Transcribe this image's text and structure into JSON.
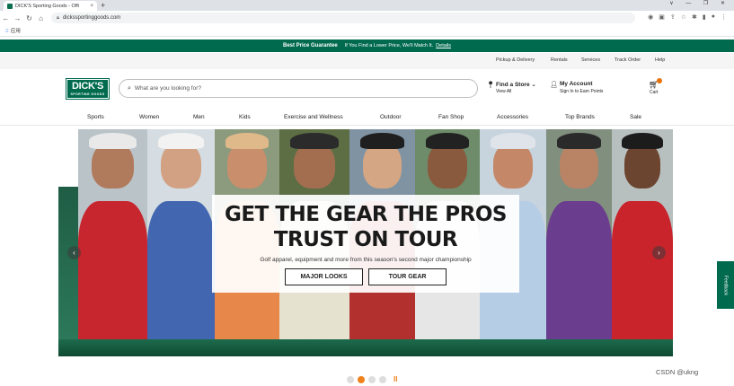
{
  "browser": {
    "tab_title": "DICK'S Sporting Goods - Offi",
    "tab_close": "×",
    "new_tab": "+",
    "url": "dickssportinggoods.com",
    "bookmark_label": "应用",
    "window_controls": "∨ — ❐ ✕"
  },
  "promo": {
    "title": "Best Price Guarantee",
    "text": "If You Find a Lower Price, We'll Match It.",
    "link": "Details"
  },
  "utility": {
    "links": [
      "Pickup & Delivery",
      "Rentals",
      "Services",
      "Track Order",
      "Help"
    ]
  },
  "header": {
    "logo_main": "DICK'S",
    "logo_sub": "SPORTING GOODS",
    "search_placeholder": "What are you looking for?",
    "store_title": "Find a Store",
    "store_sub": "View All",
    "account_title": "My Account",
    "account_sub": "Sign In to Earn Points",
    "cart_label": "Cart"
  },
  "nav": {
    "items": [
      "Sports",
      "Women",
      "Men",
      "Kids",
      "Exercise and Wellness",
      "Outdoor",
      "Fan Shop",
      "Accessories",
      "Top Brands",
      "Sale"
    ]
  },
  "hero": {
    "headline_1": "GET THE GEAR THE PROS",
    "headline_2": "TRUST ON TOUR",
    "subtext": "Golf apparel, equipment and more from this season's second major championship",
    "button_1": "MAJOR LOOKS",
    "button_2": "TOUR GEAR",
    "prev_arrow": "‹",
    "next_arrow": "›"
  },
  "carousel": {
    "active_index": 1,
    "count": 4,
    "pause": "II"
  },
  "feedback_label": "Feedback",
  "watermark": "CSDN @ukng",
  "colors": {
    "brand_green": "#006a4e",
    "accent_orange": "#f0821e"
  }
}
